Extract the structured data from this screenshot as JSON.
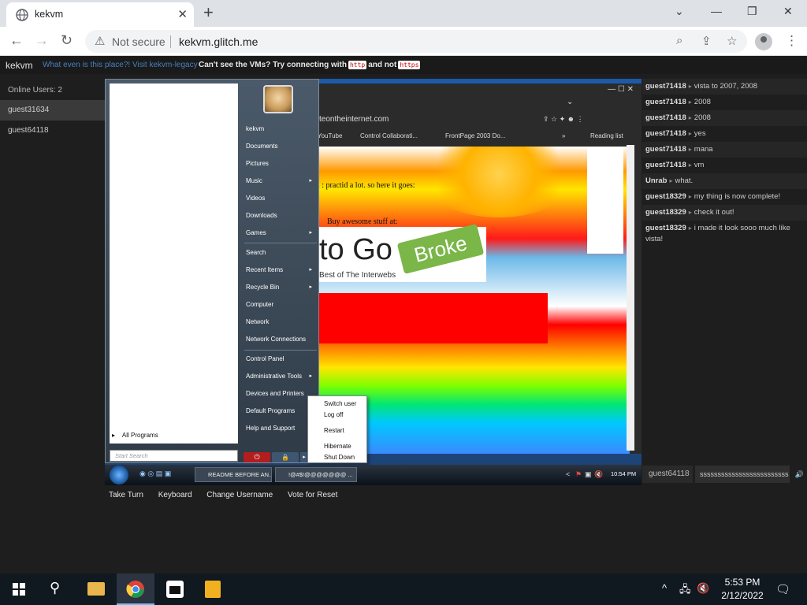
{
  "tab": {
    "title": "kekvm",
    "close": "✕"
  },
  "newtab": "+",
  "window_controls": {
    "dropdown": "⌄",
    "minimize": "—",
    "restore": "❐",
    "close": "✕"
  },
  "nav": {
    "back": "←",
    "forward": "→",
    "reload": "↻"
  },
  "omnibox": {
    "warning": "⚠",
    "not_secure": "Not secure",
    "url": "kekvm.glitch.me"
  },
  "omnibox_icons": {
    "zoom": "⌕",
    "share": "⇪",
    "star": "☆"
  },
  "menu_dots": "⋮",
  "topline": {
    "brand": "kekvm",
    "link1": "What even is this place?!",
    "link2": "Visit kekvm-legacy",
    "msg_pre": "Can't see the VMs? Try connecting with",
    "code1": "http",
    "msg_mid": "and not",
    "code2": "https"
  },
  "users": {
    "header": "Online Users: 2",
    "list": [
      "guest31634",
      "guest64118"
    ]
  },
  "chat": [
    {
      "name": "guest71418",
      "text": "vista to 2007, 2008"
    },
    {
      "name": "guest71418",
      "text": "2008"
    },
    {
      "name": "guest71418",
      "text": "2008"
    },
    {
      "name": "guest71418",
      "text": "yes"
    },
    {
      "name": "guest71418",
      "text": "mana"
    },
    {
      "name": "guest71418",
      "text": "vm"
    },
    {
      "name": "Unrab",
      "text": "what."
    },
    {
      "name": "guest18329",
      "text": "my thing is now complete!"
    },
    {
      "name": "guest18329",
      "text": "check it out!"
    },
    {
      "name": "guest18329",
      "text": "i made it look sooo much like vista!"
    }
  ],
  "chat_arrow": "▸",
  "chat_input": {
    "name": "guest64118",
    "value": "sssssssssssssssssssssssss",
    "send": "🔊"
  },
  "actions": {
    "take_turn": "Take Turn",
    "keyboard": "Keyboard",
    "change_username": "Change Username",
    "vote_reset": "Vote for Reset"
  },
  "vm_browser": {
    "url": "teontheinternet.com",
    "bookmarks": [
      "YouTube",
      "Control Collaborati...",
      "FrontPage 2003 Do...",
      "»",
      "Reading list"
    ],
    "win_buttons": "—  ☐  ✕",
    "toolbar_icons": "⇪  ☆  ✦  ☻  ⋮",
    "chevron": "⌄"
  },
  "vm_site": {
    "text1": "l : practid a lot. so here it goes:",
    "text2": "Buy awesome stuff at:",
    "logo_big": "to Go",
    "logo_tag": "Broke",
    "logo_sub": "Best of The Interwebs"
  },
  "start_menu": {
    "user": "kekvm",
    "items": [
      {
        "label": "Documents",
        "arrow": ""
      },
      {
        "label": "Pictures",
        "arrow": ""
      },
      {
        "label": "Music",
        "arrow": "▸"
      },
      {
        "label": "Videos",
        "arrow": ""
      },
      {
        "label": "Downloads",
        "arrow": ""
      },
      {
        "label": "Games",
        "arrow": "▸"
      },
      {
        "label": "Search",
        "arrow": ""
      },
      {
        "label": "Recent Items",
        "arrow": "▸"
      },
      {
        "label": "Recycle Bin",
        "arrow": "▸"
      },
      {
        "label": "Computer",
        "arrow": ""
      },
      {
        "label": "Network",
        "arrow": ""
      },
      {
        "label": "Network Connections",
        "arrow": ""
      },
      {
        "label": "Control Panel",
        "arrow": ""
      },
      {
        "label": "Administrative Tools",
        "arrow": "▸"
      },
      {
        "label": "Devices and Printers",
        "arrow": ""
      },
      {
        "label": "Default Programs",
        "arrow": ""
      },
      {
        "label": "Help and Support",
        "arrow": ""
      }
    ],
    "all_programs": "All Programs",
    "search_placeholder": "Start Search",
    "power_icon": "⏻",
    "lock_icon": "🔒",
    "arrow": "▸"
  },
  "power_menu": [
    "Switch user",
    "Log off",
    "Restart",
    "Hibernate",
    "Shut Down"
  ],
  "vm_taskbar": {
    "tasks": [
      "README BEFORE AN...",
      "!@#$!@@@@@@@ ..."
    ],
    "clock": "10:54 PM",
    "tray": [
      "<",
      "⚑",
      "▣",
      "🔇"
    ]
  },
  "taskbar": {
    "time": "5:53 PM",
    "date": "2/12/2022",
    "search_icon": "⚲",
    "tray_up": "^",
    "network": "🖧",
    "volume": "🔇",
    "notification": "🗨"
  }
}
